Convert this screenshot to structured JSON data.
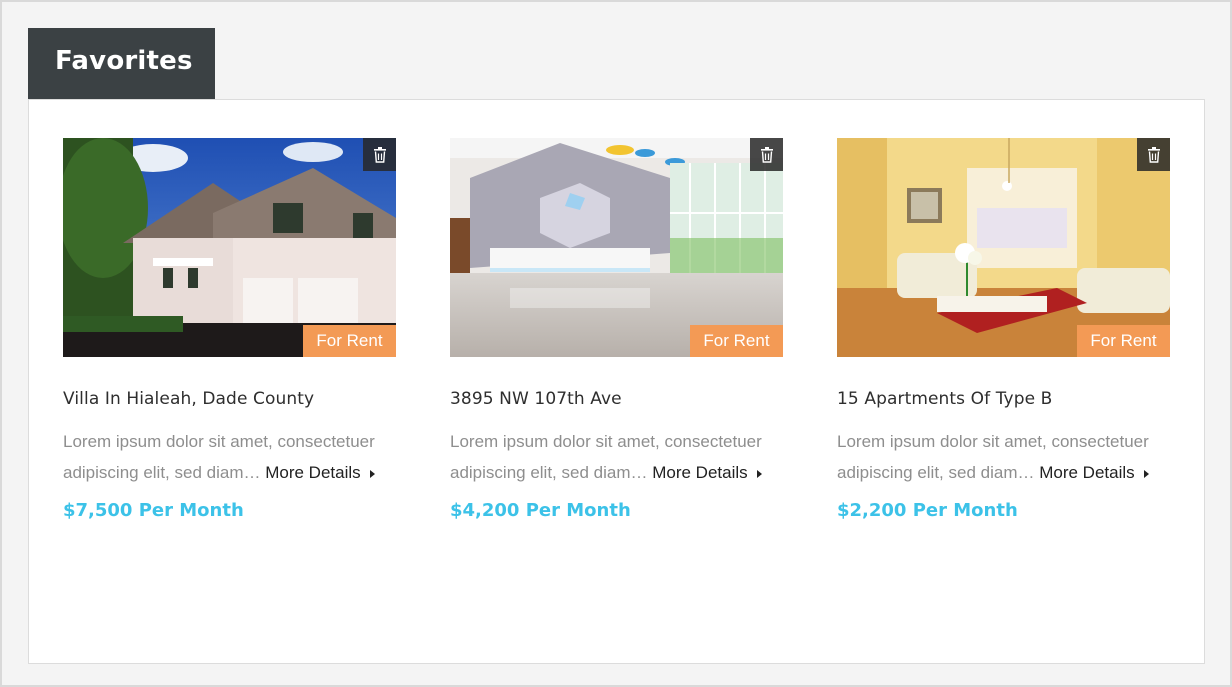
{
  "header": {
    "title": "Favorites"
  },
  "listings": [
    {
      "title": "Villa In Hialeah, Dade County",
      "badge": "For Rent",
      "description": "Lorem ipsum dolor sit amet, consectetuer adipiscing elit, sed diam…",
      "more_label": "More Details",
      "price": "$7,500 Per Month"
    },
    {
      "title": "3895 NW 107th Ave",
      "badge": "For Rent",
      "description": "Lorem ipsum dolor sit amet, consectetuer adipiscing elit, sed diam…",
      "more_label": "More Details",
      "price": "$4,200 Per Month"
    },
    {
      "title": "15 Apartments Of Type B",
      "badge": "For Rent",
      "description": "Lorem ipsum dolor sit amet, consectetuer adipiscing elit, sed diam…",
      "more_label": "More Details",
      "price": "$2,200 Per Month"
    }
  ],
  "colors": {
    "tab_background": "#3b4144",
    "badge": "#f39a55",
    "price": "#3cc2e8"
  },
  "icons": {
    "delete": "trash-icon",
    "more": "caret-right-icon"
  }
}
